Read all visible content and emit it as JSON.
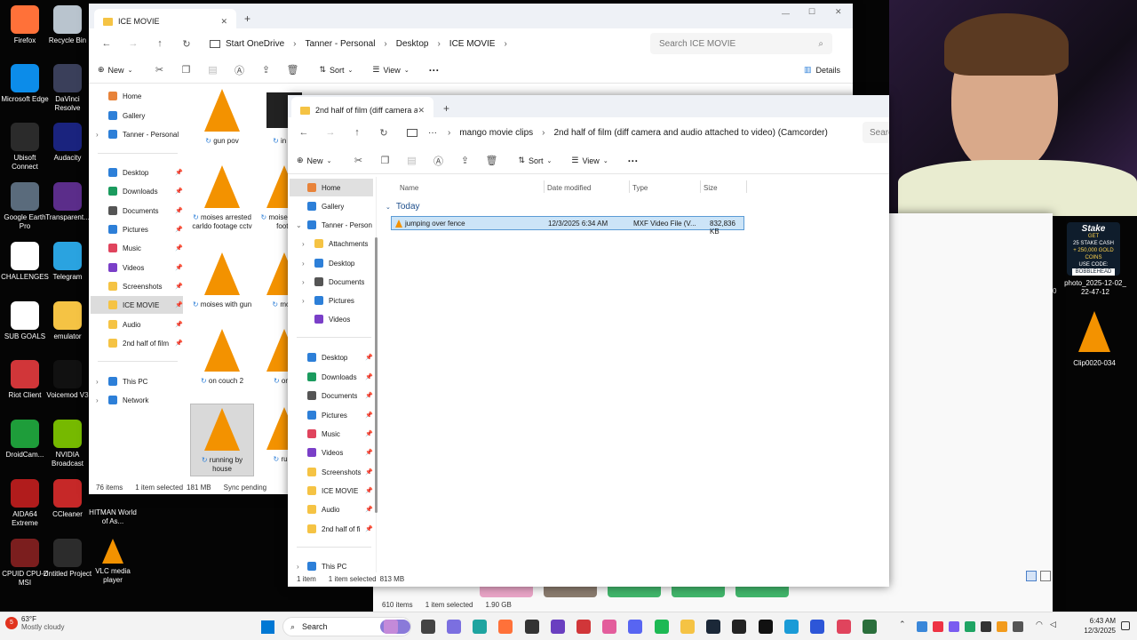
{
  "desktop": {
    "icons_left": [
      {
        "label": "Firefox"
      },
      {
        "label": "Microsoft Edge"
      },
      {
        "label": "Ubisoft Connect"
      },
      {
        "label": "Google Earth Pro"
      },
      {
        "label": "CHALLENGES"
      },
      {
        "label": "SUB GOALS"
      },
      {
        "label": "Riot Client"
      },
      {
        "label": "DroidCam..."
      },
      {
        "label": "AIDA64 Extreme"
      },
      {
        "label": "CPUID CPU-Z MSI"
      }
    ],
    "icons_col2": [
      {
        "label": "Recycle Bin"
      },
      {
        "label": "DaVinci Resolve"
      },
      {
        "label": "Audacity"
      },
      {
        "label": "Transparent..."
      },
      {
        "label": "Telegram"
      },
      {
        "label": "emulator"
      },
      {
        "label": "Voicemod V3"
      },
      {
        "label": "NVIDIA Broadcast"
      },
      {
        "label": "CCleaner"
      },
      {
        "label": "Untitled Project"
      }
    ],
    "hitman": "HITMAN World of As...",
    "vlc": "VLC media player",
    "right_icons": [
      {
        "label": "photo_2025-12-02_22-47-12"
      },
      {
        "label": "Clip0020-034"
      }
    ],
    "stake_ad": {
      "brand": "Stake",
      "line1": "GET",
      "line2": "25 STAKE CASH",
      "line3": "+ 250,000 GOLD COINS",
      "line4": "USE CODE:",
      "code": "BOBBLEHEAD"
    },
    "edge_digit": "0"
  },
  "window1": {
    "tab_title": "ICE MOVIE",
    "breadcrumbs": [
      "Start OneDrive",
      "Tanner - Personal",
      "Desktop",
      "ICE MOVIE"
    ],
    "search_placeholder": "Search ICE MOVIE",
    "cmd": {
      "new": "New",
      "sort": "Sort",
      "view": "View",
      "more": "···",
      "details": "Details"
    },
    "nav": [
      {
        "label": "Home"
      },
      {
        "label": "Gallery"
      },
      {
        "label": "Tanner - Personal"
      },
      {
        "label": "Desktop"
      },
      {
        "label": "Downloads"
      },
      {
        "label": "Documents"
      },
      {
        "label": "Pictures"
      },
      {
        "label": "Music"
      },
      {
        "label": "Videos"
      },
      {
        "label": "Screenshots"
      },
      {
        "label": "ICE MOVIE"
      },
      {
        "label": "Audio"
      },
      {
        "label": "2nd half of film"
      },
      {
        "label": "This PC"
      },
      {
        "label": "Network"
      }
    ],
    "files": [
      {
        "label": "gun pov"
      },
      {
        "label": "in ca"
      },
      {
        "label": "moises arrested carldo footage cctv"
      },
      {
        "label": "moise arrest foota"
      },
      {
        "label": "moises with gun"
      },
      {
        "label": "more"
      },
      {
        "label": "on couch 2"
      },
      {
        "label": "on c"
      },
      {
        "label": "running by house"
      },
      {
        "label": "runn"
      }
    ],
    "status": {
      "count": "76 items",
      "selected": "1 item selected",
      "size": "181 MB",
      "sync": "Sync pending"
    }
  },
  "window2": {
    "tab_title": "2nd half of film (diff camera a",
    "breadcrumbs": [
      "mango movie clips",
      "2nd half of film (diff camera and audio attached to video) (Camcorder)"
    ],
    "search_placeholder": "Search",
    "cmd": {
      "new": "New",
      "sort": "Sort",
      "view": "View",
      "more": "···"
    },
    "nav": [
      {
        "label": "Home"
      },
      {
        "label": "Gallery"
      },
      {
        "label": "Tanner - Person"
      },
      {
        "label": "Attachments"
      },
      {
        "label": "Desktop"
      },
      {
        "label": "Documents"
      },
      {
        "label": "Pictures"
      },
      {
        "label": "Videos"
      },
      {
        "label": "Desktop"
      },
      {
        "label": "Downloads"
      },
      {
        "label": "Documents"
      },
      {
        "label": "Pictures"
      },
      {
        "label": "Music"
      },
      {
        "label": "Videos"
      },
      {
        "label": "Screenshots"
      },
      {
        "label": "ICE MOVIE"
      },
      {
        "label": "Audio"
      },
      {
        "label": "2nd half of fi"
      },
      {
        "label": "This PC"
      }
    ],
    "columns": [
      "Name",
      "Date modified",
      "Type",
      "Size"
    ],
    "group": "Today",
    "rows": [
      {
        "name": "jumping over fence",
        "date": "12/3/2025 6:34 AM",
        "type": "MXF Video File (V...",
        "size": "832,836 KB"
      }
    ],
    "status": {
      "count": "1 item",
      "selected": "1 item selected",
      "size": "813 MB"
    }
  },
  "window3": {
    "status": {
      "count": "610 items",
      "selected": "1 item selected",
      "size": "1.90 GB"
    }
  },
  "taskbar": {
    "weather_temp": "63°F",
    "weather_desc": "Mostly cloudy",
    "search": "Search",
    "time": "6:43 AM",
    "date": "12/3/2025",
    "badge": "5"
  }
}
